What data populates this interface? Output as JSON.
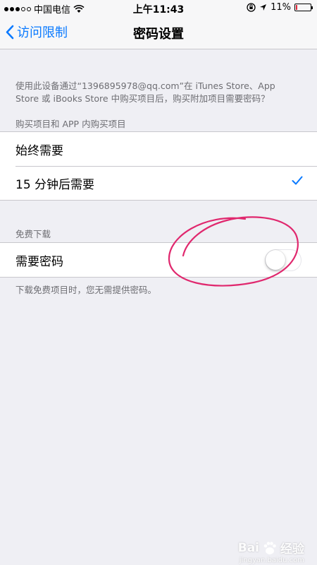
{
  "status_bar": {
    "carrier": "中国电信",
    "time": "上午11:43",
    "battery": "11%",
    "battery_level": 0.11
  },
  "nav": {
    "back_label": "访问限制",
    "title": "密码设置"
  },
  "description": "使用此设备通过“1396895978@qq.com”在 iTunes Store、App Store 或 iBooks Store 中购买项目后，购买附加项目需要密码？",
  "purchases": {
    "header": "购买项目和 APP 内购买项目",
    "options": [
      {
        "label": "始终需要",
        "selected": false
      },
      {
        "label": "15 分钟后需要",
        "selected": true
      }
    ]
  },
  "free_downloads": {
    "header": "免费下载",
    "require_password_label": "需要密码",
    "require_password_on": false,
    "footer": "下载免费项目时，您无需提供密码。"
  },
  "colors": {
    "accent": "#0a7aff",
    "annotation": "#e0286e"
  },
  "watermark": {
    "brand": "Bai",
    "brand_cn": "经验",
    "url": "jingyan.baidu.com"
  }
}
